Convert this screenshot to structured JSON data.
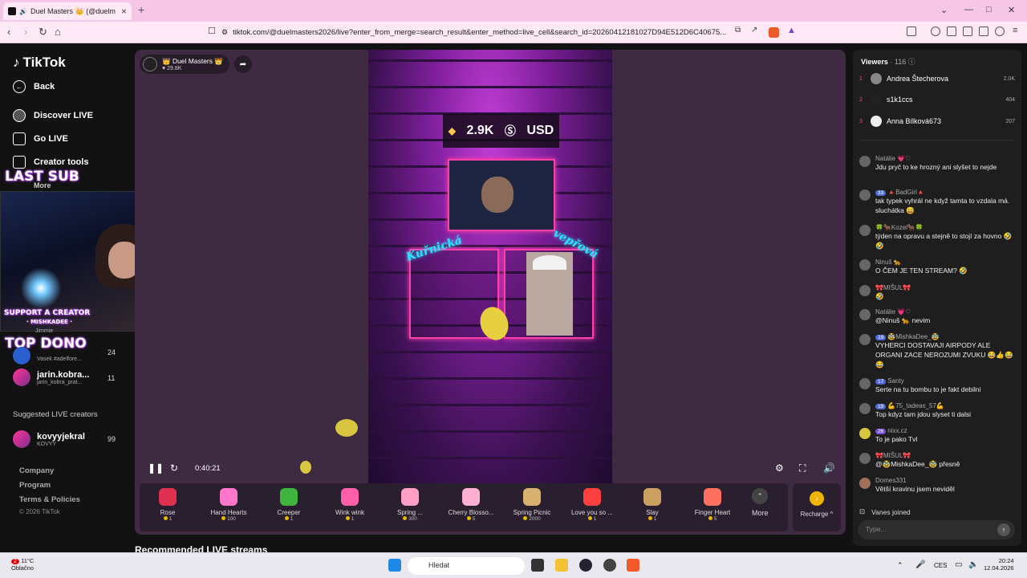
{
  "browser": {
    "tab_title": "Duel Masters 👑 (@duelm",
    "new_tab": "+",
    "url": "tiktok.com/@duelmasters2026/live?enter_from_merge=search_result&enter_method=live_cell&search_id=20260412181027D94E512D6C40675..."
  },
  "nav": {
    "logo": "TikTok",
    "back": "Back",
    "discover": "Discover LIVE",
    "go_live": "Go LIVE",
    "creator_tools": "Creator tools",
    "more": "More"
  },
  "overlay": {
    "last_sub": "LAST SUB",
    "support": "SUPPORT A CREATOR",
    "support_name": "· MISHKADEE ·",
    "top_dono": "TOP DONO",
    "partial_name": "Jimmie"
  },
  "leaderboard": [
    {
      "name": "",
      "sub": "Vasek #adelfore...",
      "count": "24"
    },
    {
      "name": "jarin.kobra...",
      "sub": "jarin_kobra_prat...",
      "count": "11"
    }
  ],
  "suggested": {
    "heading": "Suggested LIVE creators",
    "items": [
      {
        "name": "kovyyjekral",
        "sub": "KOVYY",
        "count": "99"
      }
    ]
  },
  "footer": {
    "company": "Company",
    "program": "Program",
    "terms": "Terms & Policies",
    "copyright": "© 2026 TikTok"
  },
  "player": {
    "host_name": "👑 Duel Masters 👑",
    "host_likes": "♥ 29.8K",
    "coins": "2.9K",
    "currency": "USD",
    "elapsed": "0:40:21",
    "neon_left": "Kuřnická",
    "neon_right": "vepřová"
  },
  "gifts": [
    {
      "name": "Rose",
      "price": "1",
      "color": "#e0304f"
    },
    {
      "name": "Hand Hearts",
      "price": "100",
      "color": "#ff77c8"
    },
    {
      "name": "Creeper",
      "price": "1",
      "color": "#3fb43f"
    },
    {
      "name": "Wink wink",
      "price": "1",
      "color": "#ff5fa8"
    },
    {
      "name": "Spring ...",
      "price": "300",
      "color": "#ff9fc6"
    },
    {
      "name": "Cherry Blosso...",
      "price": "5",
      "color": "#ffb0d0"
    },
    {
      "name": "Spring Picnic",
      "price": "2000",
      "color": "#d8b070"
    },
    {
      "name": "Love you so ...",
      "price": "1",
      "color": "#ff4040"
    },
    {
      "name": "Slay",
      "price": "1",
      "color": "#c9a060"
    },
    {
      "name": "Finger Heart",
      "price": "5",
      "color": "#ff7060"
    }
  ],
  "gifts_more": "More",
  "recharge": "Recharge ^",
  "recommended": "Recommended LIVE streams",
  "viewers": {
    "label": "Viewers",
    "count": "· 116",
    "top": [
      {
        "rank": "1",
        "name": "Andrea Štecherova",
        "score": "2.0K"
      },
      {
        "rank": "2",
        "name": "s1k1ccs",
        "score": "404"
      },
      {
        "rank": "3",
        "name": "Anna Bílková673",
        "score": "207"
      }
    ]
  },
  "chat": [
    {
      "badge": "",
      "user": "Natálie 💗♡",
      "text": "Jdu pryč to ke hrozný ani slyšet to nejde"
    },
    {
      "badge": "33",
      "user": "🔺BadGirl🔺",
      "text": "tak typek vyhrál ne když tamta to vzdala má. sluchátka 😅"
    },
    {
      "badge": "",
      "user": "🍀🐂Kozel🐂🍀",
      "text": "týden na opravu a stejně to stojí za hovno 🤣🤣"
    },
    {
      "badge": "",
      "user": "Ninuš 🐆",
      "text": "O ČEM JE TEN STREAM? 🤣"
    },
    {
      "badge": "",
      "user": "🎀MIŠUL🎀",
      "text": "🤣"
    },
    {
      "badge": "",
      "user": "Natálie 💗♡",
      "text": "@Ninuš 🐆 nevim"
    },
    {
      "badge": "19",
      "user": "🥸MishkaDee_🥸",
      "text": "VYHERCI DOSTAVAJI AIRPODY ALE ORGANI ZACE NEROZUMI ZVUKU 😂👍😂😂"
    },
    {
      "badge": "17",
      "user": "Santy",
      "text": "Serte na tu bombu to je fakt debilni"
    },
    {
      "badge": "19",
      "user": "💪75_tadeas_57💪",
      "text": "Top kdyz tam jdou slyset ti dalsi"
    },
    {
      "badge": "26",
      "user": "nixx.cz",
      "text": "To je pako Tvl"
    },
    {
      "badge": "",
      "user": "🎀MIŠUL🎀",
      "text": "@🥸MishkaDee_🥸 přesně"
    },
    {
      "badge": "",
      "user": "Domes331",
      "text": "Větší kravinu jsem neviděl"
    }
  ],
  "joined": "Vanes joined",
  "chat_placeholder": "Type...",
  "taskbar": {
    "temp": "11°C",
    "condition": "Oblačno",
    "alert": "2",
    "search": "Hledat",
    "lang": "CES",
    "time": "20:24",
    "date": "12.04.2026"
  }
}
